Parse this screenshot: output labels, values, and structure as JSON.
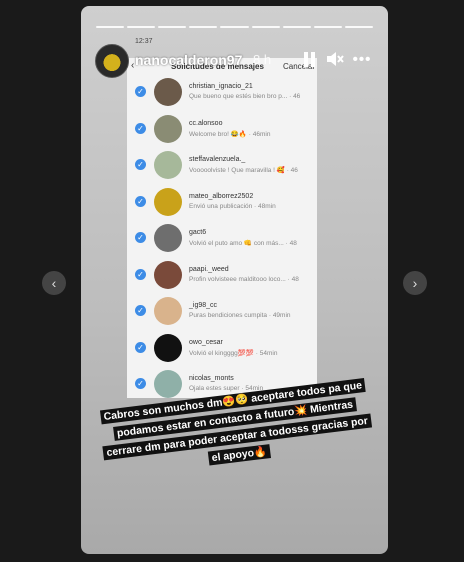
{
  "header": {
    "username": "nanocalderon97",
    "time_ago": "8 h",
    "more": "•••"
  },
  "status_bar": {
    "clock": "12:37"
  },
  "requests": {
    "title": "Solicitudes de mensajes",
    "cancel": "Cancelar",
    "back": "‹",
    "rows": [
      {
        "name": "christian_ignacio_21",
        "message": "Que bueno que estés bien bro p... · 46",
        "avatar_color": "#6b5a4a"
      },
      {
        "name": "cc.alonsoo",
        "message": "Welcome bro! 😂🔥 · 46min",
        "avatar_color": "#8a8c74"
      },
      {
        "name": "steffavalenzuela._",
        "message": "Vooooolviste ! Que maravilla ! 🥰 · 46",
        "avatar_color": "#a6b89a"
      },
      {
        "name": "mateo_alborrez2502",
        "message": "Envió una publicación · 48min",
        "avatar_color": "#c9a21a"
      },
      {
        "name": "gact6",
        "message": "Volvió el puto amo 👊 con más... · 48",
        "avatar_color": "#6e6e6e"
      },
      {
        "name": "paapi._weed",
        "message": "Profin volvisteee malditooo loco... · 48",
        "avatar_color": "#7a4a3a"
      },
      {
        "name": "_ig98_cc",
        "message": "Puras bendiciones cumpita · 49min",
        "avatar_color": "#d9b38c"
      },
      {
        "name": "owo_cesar",
        "message": "Volvió el kingggg💯💯 · 54min",
        "avatar_color": "#111111"
      },
      {
        "name": "nicolas_monts",
        "message": "Ojala estes super · 54min",
        "avatar_color": "#8fb0a8"
      }
    ]
  },
  "caption": "Cabros son muchos dm😍🥺 aceptare todos pa que podamos estar en contacto a futuro💥 Mientras cerrare dm para poder aceptar a todosss gracias por el apoyo🔥",
  "nav": {
    "prev": "‹",
    "next": "›"
  },
  "colors": {
    "check": "#3d8ce6",
    "backdrop": "#1a1a1a"
  }
}
